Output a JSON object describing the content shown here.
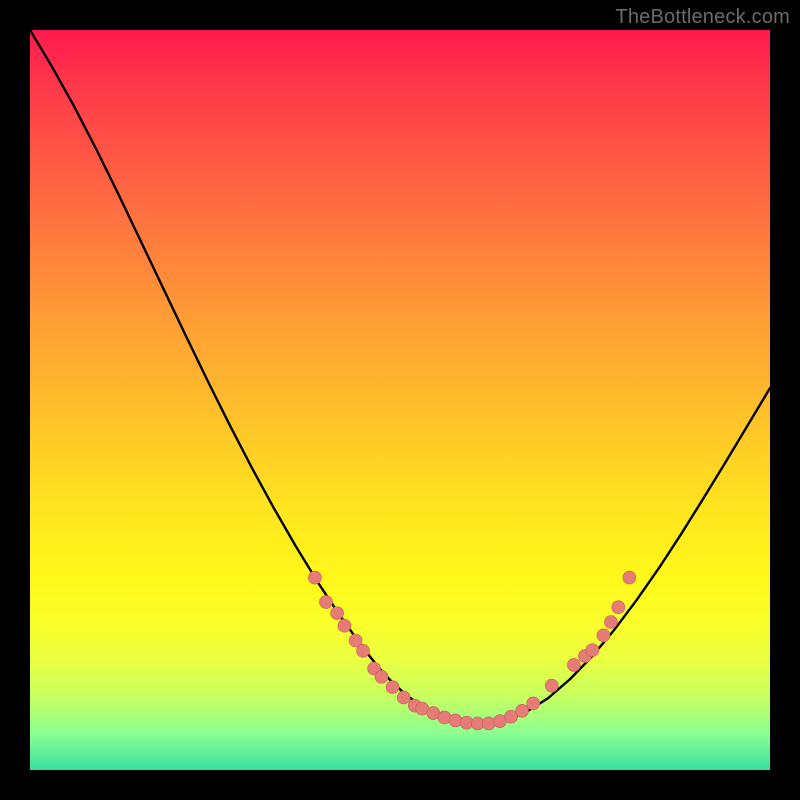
{
  "watermark": "TheBottleneck.com",
  "colors": {
    "frame": "#000000",
    "curve_stroke": "#000000",
    "marker_fill": "#e77b78",
    "marker_stroke": "#c45b57"
  },
  "chart_data": {
    "type": "line",
    "title": "",
    "xlabel": "",
    "ylabel": "",
    "xlim": [
      0,
      100
    ],
    "ylim": [
      0,
      100
    ],
    "grid": false,
    "legend": "none",
    "x": [
      0,
      3,
      6,
      9,
      12,
      15,
      18,
      21,
      24,
      27,
      30,
      33,
      36,
      39,
      42,
      45,
      47,
      49,
      51,
      53,
      55,
      58,
      61,
      64,
      67,
      70,
      73,
      76,
      79,
      82,
      85,
      88,
      91,
      94,
      97,
      100
    ],
    "values": [
      100,
      95,
      89.6,
      83.8,
      77.7,
      71.4,
      65.1,
      58.8,
      52.6,
      46.6,
      40.8,
      35.3,
      30.1,
      25.2,
      20.7,
      16.5,
      14.0,
      11.8,
      10.0,
      8.6,
      7.6,
      6.6,
      6.2,
      6.6,
      7.8,
      9.7,
      12.3,
      15.4,
      19.0,
      23.0,
      27.3,
      31.9,
      36.7,
      41.6,
      46.6,
      51.6
    ],
    "markers": [
      {
        "x": 38.5,
        "y": 26.0
      },
      {
        "x": 40.0,
        "y": 22.7
      },
      {
        "x": 41.5,
        "y": 21.2
      },
      {
        "x": 42.5,
        "y": 19.5
      },
      {
        "x": 44.0,
        "y": 17.5
      },
      {
        "x": 45.0,
        "y": 16.1
      },
      {
        "x": 46.5,
        "y": 13.7
      },
      {
        "x": 47.5,
        "y": 12.6
      },
      {
        "x": 49.0,
        "y": 11.2
      },
      {
        "x": 50.5,
        "y": 9.8
      },
      {
        "x": 52.0,
        "y": 8.7
      },
      {
        "x": 53.0,
        "y": 8.3
      },
      {
        "x": 54.5,
        "y": 7.7
      },
      {
        "x": 56.0,
        "y": 7.1
      },
      {
        "x": 57.5,
        "y": 6.7
      },
      {
        "x": 59.0,
        "y": 6.4
      },
      {
        "x": 60.5,
        "y": 6.3
      },
      {
        "x": 62.0,
        "y": 6.3
      },
      {
        "x": 63.5,
        "y": 6.6
      },
      {
        "x": 65.0,
        "y": 7.2
      },
      {
        "x": 66.5,
        "y": 8.0
      },
      {
        "x": 68.0,
        "y": 9.0
      },
      {
        "x": 70.5,
        "y": 11.4
      },
      {
        "x": 73.5,
        "y": 14.2
      },
      {
        "x": 75.0,
        "y": 15.4
      },
      {
        "x": 76.0,
        "y": 16.2
      },
      {
        "x": 77.5,
        "y": 18.2
      },
      {
        "x": 78.5,
        "y": 20.0
      },
      {
        "x": 79.5,
        "y": 22.0
      },
      {
        "x": 81.0,
        "y": 26.0
      }
    ]
  }
}
